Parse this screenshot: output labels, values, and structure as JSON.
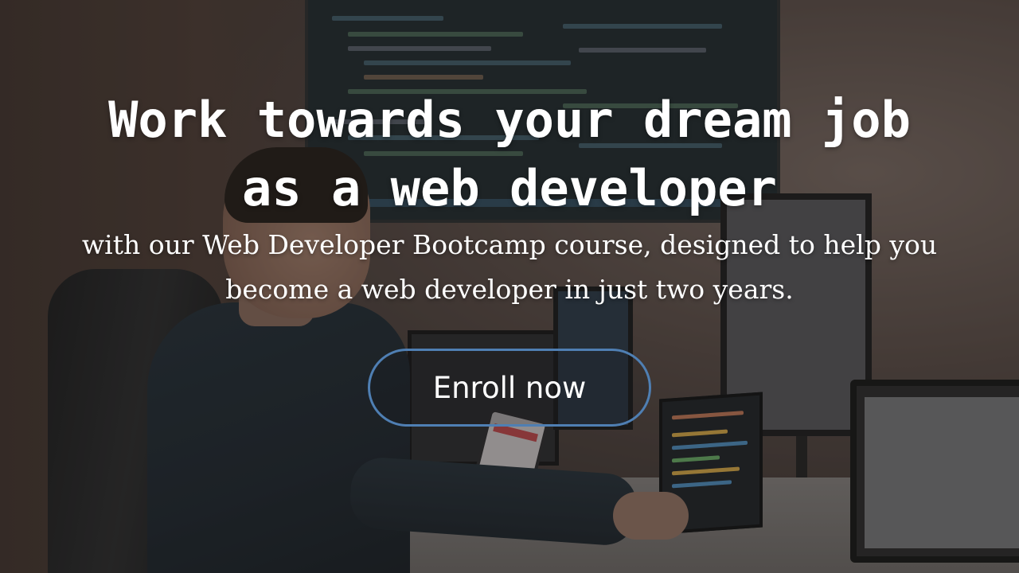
{
  "hero": {
    "headline_line1": "Work towards your dream job",
    "headline_line2": "as a web developer",
    "subline_line1": "with our Web Developer Bootcamp course, designed to help you",
    "subline_line2": "become a web developer in just two years."
  },
  "cta": {
    "label": "Enroll now",
    "border_color": "#4f7fb3"
  },
  "colors": {
    "text": "#ffffff"
  }
}
